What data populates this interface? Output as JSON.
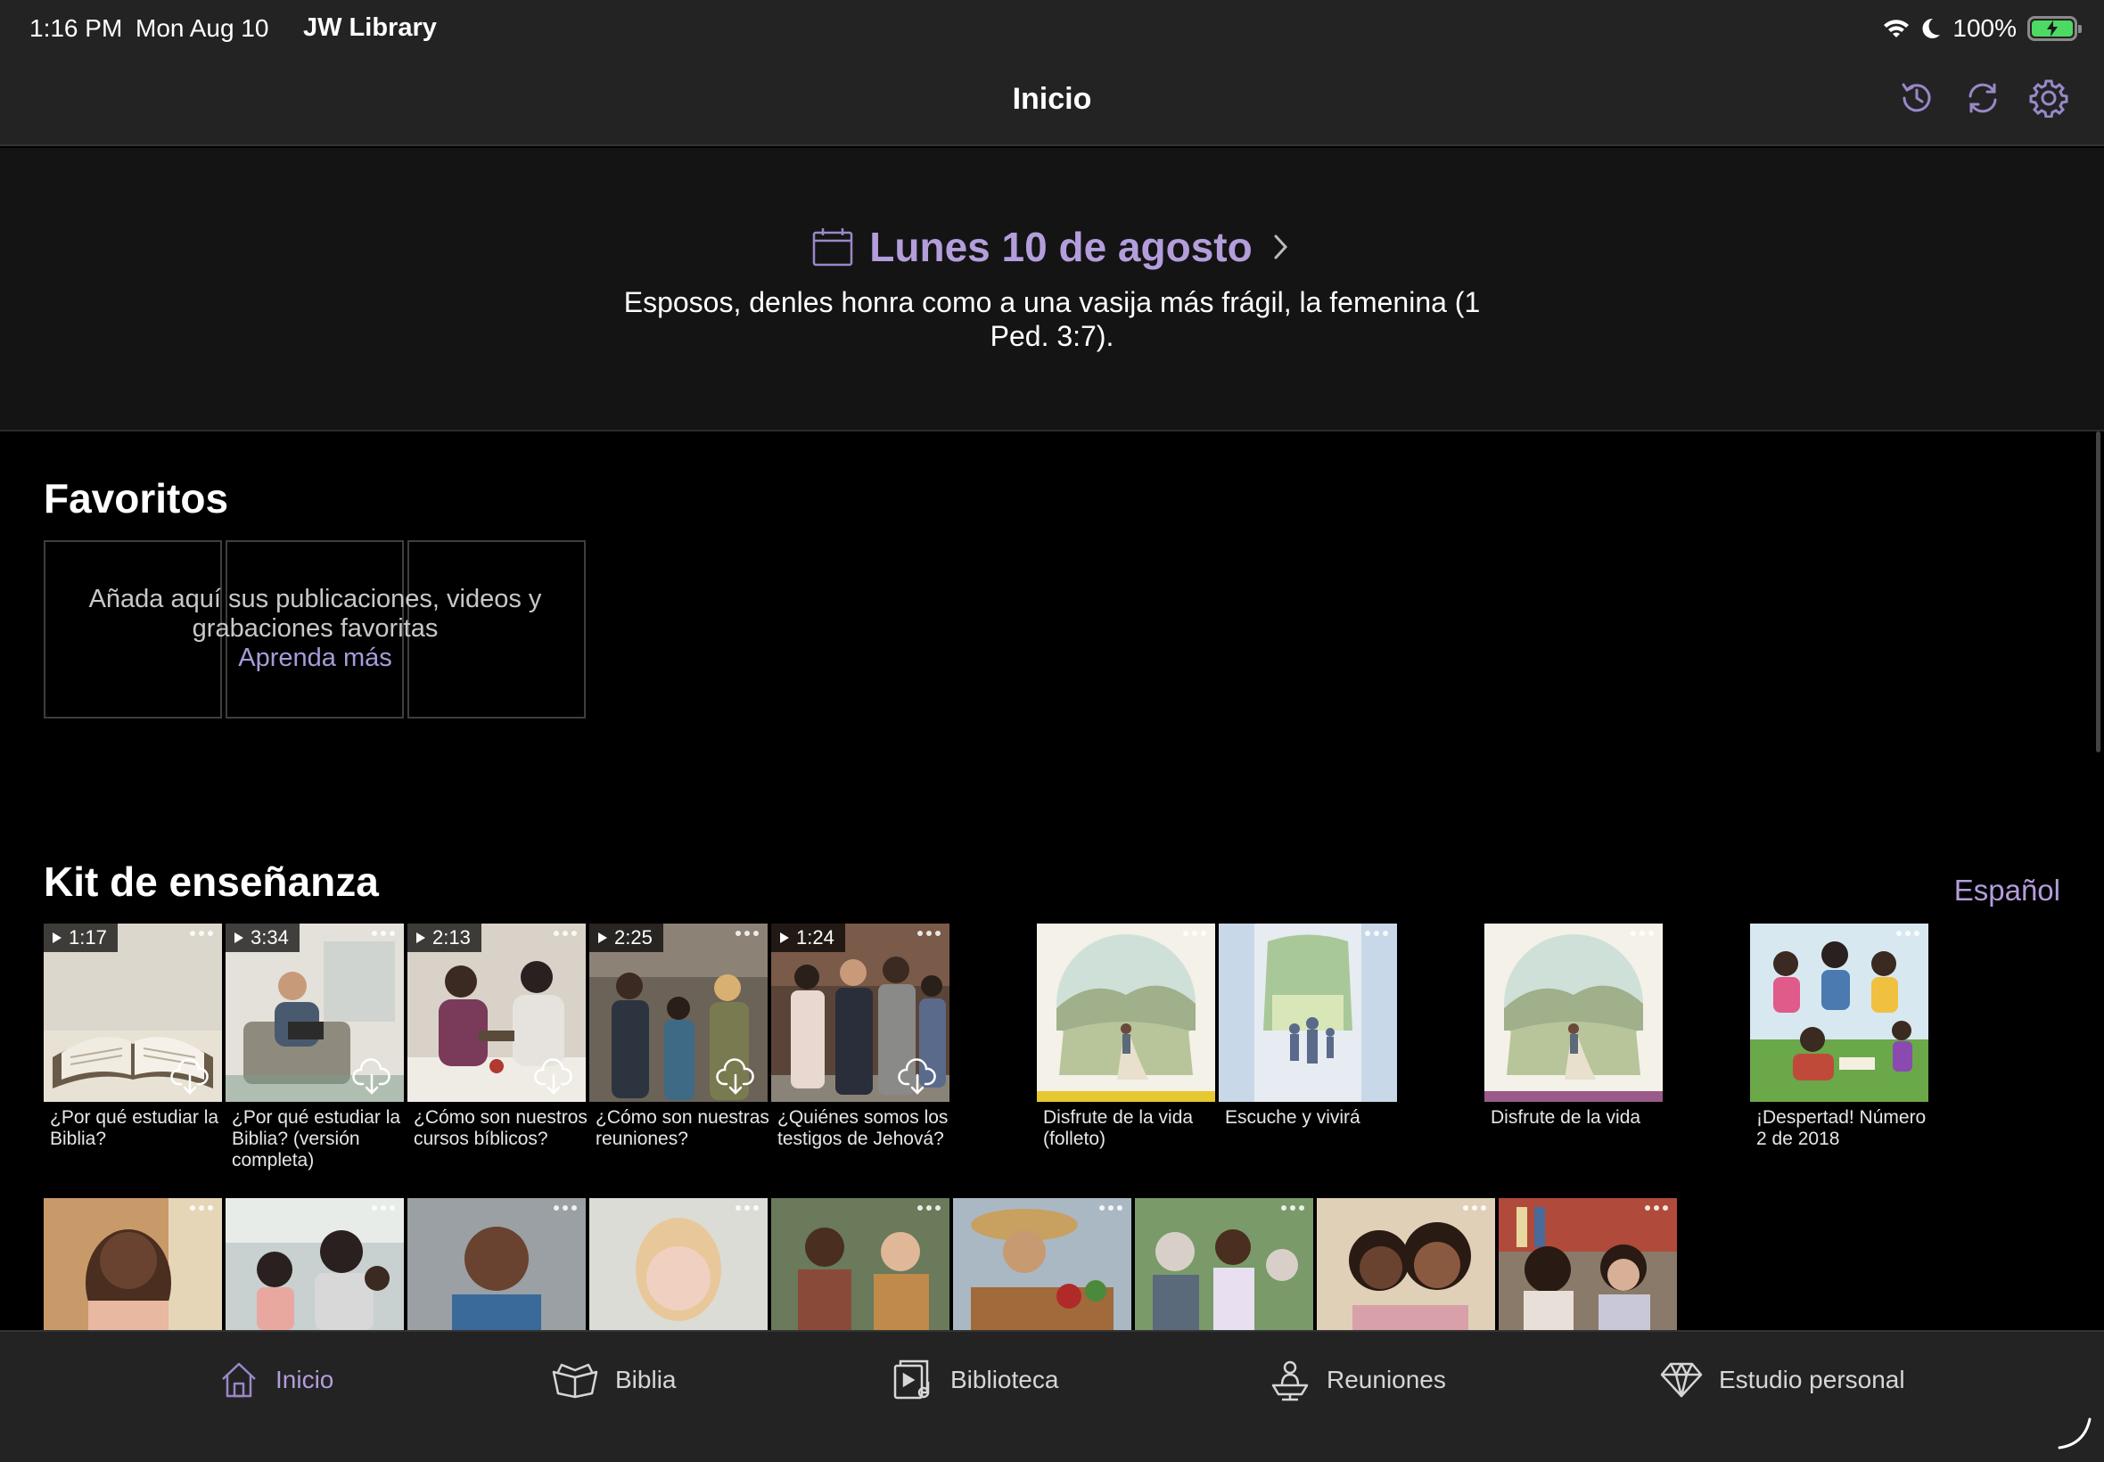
{
  "status_bar": {
    "time": "1:16 PM",
    "date": "Mon Aug 10",
    "app_name": "JW Library",
    "battery": "100%",
    "battery_level": 1.0,
    "icons": [
      "wifi-icon",
      "do-not-disturb-moon-icon",
      "battery-charging-icon"
    ]
  },
  "nav": {
    "title": "Inicio",
    "icons": [
      "history-icon",
      "sync-icon",
      "settings-gear-icon"
    ]
  },
  "daily_text": {
    "date": "Lunes 10 de agosto",
    "text": "Esposos, denles honra como a una vasija más frágil, la femenina (1 Ped. 3:7)."
  },
  "favorites": {
    "title": "Favoritos",
    "message": "Añada aquí sus publicaciones, videos y grabaciones favoritas",
    "link": "Aprenda más"
  },
  "teaching_kit": {
    "title": "Kit de enseñanza",
    "language": "Español",
    "row1": [
      {
        "kind": "video",
        "duration": "1:17",
        "caption": "¿Por qué estudiar la Biblia?"
      },
      {
        "kind": "video",
        "duration": "3:34",
        "caption": "¿Por qué estudiar la Biblia? (versión completa)"
      },
      {
        "kind": "video",
        "duration": "2:13",
        "caption": "¿Cómo son nuestros cursos bíblicos?"
      },
      {
        "kind": "video",
        "duration": "2:25",
        "caption": "¿Cómo son nuestras reuniones?"
      },
      {
        "kind": "video",
        "duration": "1:24",
        "caption": "¿Quiénes somos los testigos de Jehová?"
      },
      {
        "kind": "publication",
        "caption": "Disfrute de la vida (folleto)"
      },
      {
        "kind": "publication",
        "caption": "Escuche y vivirá"
      },
      {
        "kind": "publication",
        "caption": "Disfrute de la vida"
      },
      {
        "kind": "publication",
        "caption": "¡Despertad! Número 2 de 2018"
      }
    ],
    "row2_count": 9
  },
  "tabs": [
    {
      "label": "Inicio",
      "icon": "home-icon",
      "active": true
    },
    {
      "label": "Biblia",
      "icon": "open-book-icon",
      "active": false
    },
    {
      "label": "Biblioteca",
      "icon": "media-library-icon",
      "active": false
    },
    {
      "label": "Reuniones",
      "icon": "person-lectern-icon",
      "active": false
    },
    {
      "label": "Estudio personal",
      "icon": "diamond-icon",
      "active": false
    }
  ],
  "colors": {
    "accent": "#b39ddb",
    "bar_background": "#232323",
    "daily_background": "#141414",
    "background": "#000000"
  }
}
